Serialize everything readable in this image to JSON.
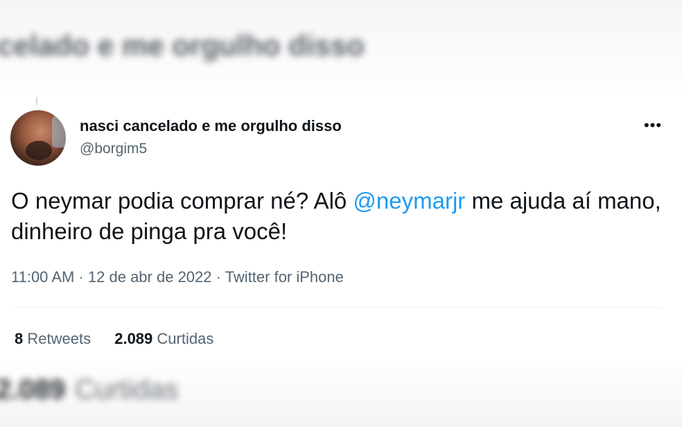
{
  "background": {
    "blurred_title": "celado e me orgulho disso",
    "blurred_bottom_count": "2.089",
    "blurred_bottom_label": "Curtidas"
  },
  "tweet": {
    "display_name": "nasci cancelado e me orgulho disso",
    "handle": "@borgim5",
    "more_icon": "more-options-icon",
    "text_part1": "O neymar podia comprar né? Alô ",
    "mention": "@neymarjr",
    "text_part2": " me ajuda aí mano, dinheiro de pinga pra você!",
    "time": "11:00 AM",
    "date": "12 de abr de 2022",
    "source": "Twitter for iPhone",
    "separator": "·",
    "retweets_count": "8",
    "retweets_label": "Retweets",
    "likes_count": "2.089",
    "likes_label": "Curtidas"
  },
  "colors": {
    "accent": "#1d9bf0",
    "text_primary": "#0f1419",
    "text_secondary": "#536471"
  }
}
